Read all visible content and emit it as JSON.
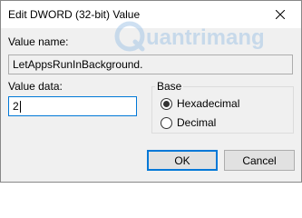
{
  "window": {
    "title": "Edit DWORD (32-bit) Value"
  },
  "watermark": {
    "text": "uantrimang"
  },
  "fields": {
    "value_name_label": "Value name:",
    "value_name": "LetAppsRunInBackground.",
    "value_data_label": "Value data:",
    "value_data": "2"
  },
  "base": {
    "title": "Base",
    "options": [
      {
        "label": "Hexadecimal",
        "selected": true
      },
      {
        "label": "Decimal",
        "selected": false
      }
    ]
  },
  "buttons": {
    "ok": "OK",
    "cancel": "Cancel"
  },
  "colors": {
    "accent": "#0078d7",
    "dialog_bg": "#f0f0f0"
  }
}
